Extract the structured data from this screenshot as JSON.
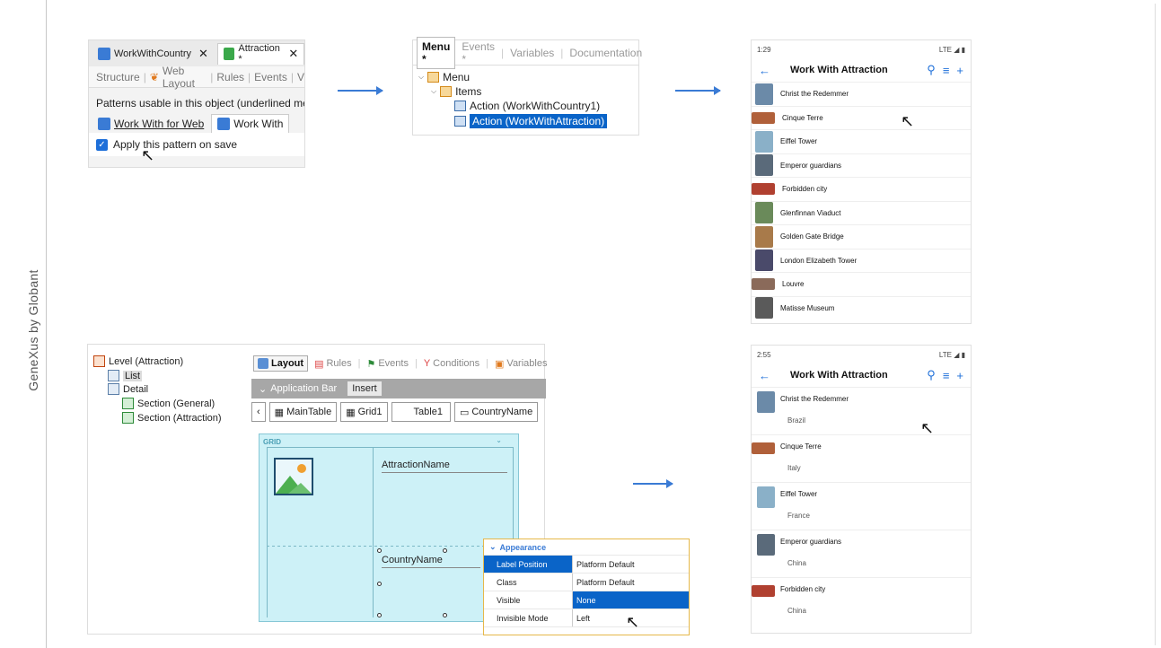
{
  "sidebar": {
    "brand": "GeneXus by Globant"
  },
  "panel1": {
    "tabs": [
      {
        "label": "WorkWithCountry"
      },
      {
        "label": "Attraction *"
      }
    ],
    "subtabs": [
      "Structure",
      "Web Layout",
      "Rules",
      "Events",
      "V"
    ],
    "description": "Patterns usable in this object (underlined mea",
    "pattern_tabs": [
      "Work With for Web",
      "Work With"
    ],
    "checkbox_label": "Apply this pattern on save"
  },
  "panel2": {
    "tabs": [
      "Menu *",
      "Events *",
      "Variables",
      "Documentation"
    ],
    "tree": [
      "Menu",
      "Items",
      "Action (WorkWithCountry1)",
      "Action (WorkWithAttraction)"
    ]
  },
  "phone1": {
    "time": "1:29",
    "signal": "LTE",
    "title": "Work With Attraction",
    "items": [
      "Christ the Redemmer",
      "Cinque Terre",
      "Eiffel Tower",
      "Emperor guardians",
      "Forbidden city",
      "Glenfinnan Viaduct",
      "Golden Gate Bridge",
      "London Elizabeth Tower",
      "Louvre",
      "Matisse Museum"
    ]
  },
  "phone2": {
    "time": "2:55",
    "signal": "LTE",
    "title": "Work With Attraction",
    "items": [
      {
        "name": "Christ the Redemmer",
        "country": "Brazil"
      },
      {
        "name": "Cinque Terre",
        "country": "Italy"
      },
      {
        "name": "Eiffel Tower",
        "country": "France"
      },
      {
        "name": "Emperor guardians",
        "country": "China"
      },
      {
        "name": "Forbidden city",
        "country": "China"
      }
    ]
  },
  "editor": {
    "tree": [
      "Level (Attraction)",
      "List",
      "Detail",
      "Section (General)",
      "Section (Attraction)"
    ],
    "tabs": [
      "Layout",
      "Rules",
      "Events",
      "Conditions",
      "Variables"
    ],
    "app_bar": "Application Bar",
    "insert": "Insert",
    "controls": [
      "MainTable",
      "Grid1",
      "Table1",
      "CountryName"
    ],
    "grid_label": "GRID",
    "fields": [
      "AttractionName",
      "CountryName"
    ]
  },
  "properties": {
    "header": "Appearance",
    "rows": [
      {
        "key": "Label Position",
        "value": "Platform Default"
      },
      {
        "key": "Class",
        "value": "Platform Default"
      },
      {
        "key": "Visible",
        "value": "None"
      },
      {
        "key": "Invisible Mode",
        "value": "Left"
      }
    ]
  }
}
